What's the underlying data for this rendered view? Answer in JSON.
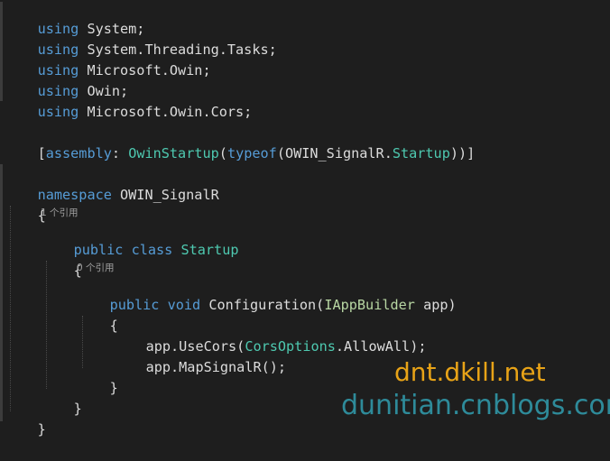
{
  "code": {
    "usings": [
      {
        "keyword": "using",
        "ns": " System;"
      },
      {
        "keyword": "using",
        "ns": " System.Threading.Tasks;"
      },
      {
        "keyword": "using",
        "ns": " Microsoft.Owin;"
      },
      {
        "keyword": "using",
        "ns": " Owin;"
      },
      {
        "keyword": "using",
        "ns": " Microsoft.Owin.Cors;"
      }
    ],
    "attribute": {
      "open": "[",
      "assembly": "assembly",
      "colon": ": ",
      "owin_startup": "OwinStartup",
      "paren_open": "(",
      "typeof": "typeof",
      "paren_open2": "(",
      "ns": "OWIN_SignalR.",
      "startup": "Startup",
      "close": "))]"
    },
    "namespace_line": {
      "keyword": "namespace",
      "name": " OWIN_SignalR"
    },
    "brace_open_ns": "{",
    "class_lens": "1 个引用",
    "class_decl": {
      "kw_public": "public",
      "kw_class": " class",
      "name": " Startup"
    },
    "brace_open_class": "{",
    "method_lens": "0 个引用",
    "method_decl": {
      "kw_public": "public",
      "kw_void": " void",
      "name": " Configuration(",
      "param_type": "IAppBuilder",
      "param_rest": " app)"
    },
    "brace_open_method": "{",
    "stmt1": {
      "prefix": "app.UseCors(",
      "type": "CorsOptions",
      "suffix": ".AllowAll);"
    },
    "stmt2": "app.MapSignalR();",
    "brace_close_method": "}",
    "brace_close_class": "}",
    "brace_close_ns": "}"
  },
  "watermarks": {
    "top": "dnt.dkill.net",
    "bottom": "dunitian.cnblogs.com"
  },
  "colors": {
    "background": "#1e1e1e",
    "keyword": "#569cd6",
    "type": "#4ec9b0",
    "interface": "#b8d7a3",
    "text": "#dcdcdc",
    "watermark_top": "#e8a317",
    "watermark_bottom": "#2e8b9a"
  }
}
